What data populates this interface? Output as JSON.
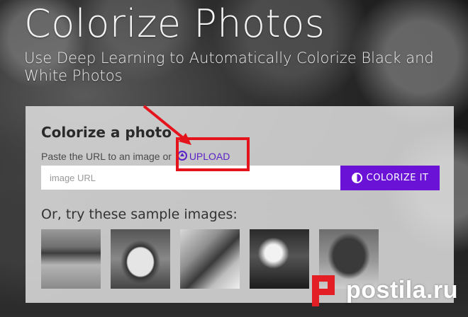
{
  "hero": {
    "title": "Colorize Photos",
    "subtitle": "Use Deep Learning to Automatically Colorize Black and White Photos"
  },
  "card": {
    "heading": "Colorize a photo",
    "hint_text": "Paste the URL to an image or",
    "upload_label": "UPLOAD",
    "url_placeholder": "image URL",
    "colorize_label": "COLORIZE IT",
    "samples_heading": "Or, try these sample images:"
  },
  "samples": [
    {
      "icon": "sample-bird-shore"
    },
    {
      "icon": "sample-race-car"
    },
    {
      "icon": "sample-mountain"
    },
    {
      "icon": "sample-portrait"
    },
    {
      "icon": "sample-cattle"
    }
  ],
  "colors": {
    "accent": "#6a12d6",
    "link": "#5b21c7",
    "annotation": "#e5141c",
    "watermark_red": "#e31e24"
  },
  "watermark": {
    "text": "postila.ru"
  }
}
